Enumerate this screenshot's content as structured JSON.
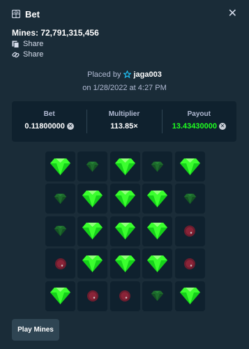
{
  "header": {
    "title": "Bet",
    "close_icon": "close-icon"
  },
  "bet_info": {
    "mines_label": "Mines: 72,791,315,456",
    "share_links": [
      "Share",
      "Share"
    ]
  },
  "placement": {
    "placed_by_label": "Placed by",
    "username": "jaga003",
    "date_line": "on 1/28/2022 at 4:27 PM"
  },
  "stats": {
    "bet": {
      "label": "Bet",
      "value": "0.11800000"
    },
    "multiplier": {
      "label": "Multiplier",
      "value": "113.85×"
    },
    "payout": {
      "label": "Payout",
      "value": "13.43430000"
    },
    "payout_color": "#1fff20"
  },
  "board": {
    "tiles": [
      "gem",
      "gem-dim",
      "gem",
      "gem-dim",
      "gem",
      "gem-dim",
      "gem",
      "gem",
      "gem",
      "gem-dim",
      "gem-dim",
      "gem",
      "gem",
      "gem",
      "mine-dim",
      "mine-dim",
      "gem",
      "gem",
      "gem",
      "mine-dim",
      "gem",
      "mine-dim",
      "mine-dim",
      "gem-dim",
      "gem"
    ]
  },
  "footer": {
    "play_button": "Play Mines"
  }
}
